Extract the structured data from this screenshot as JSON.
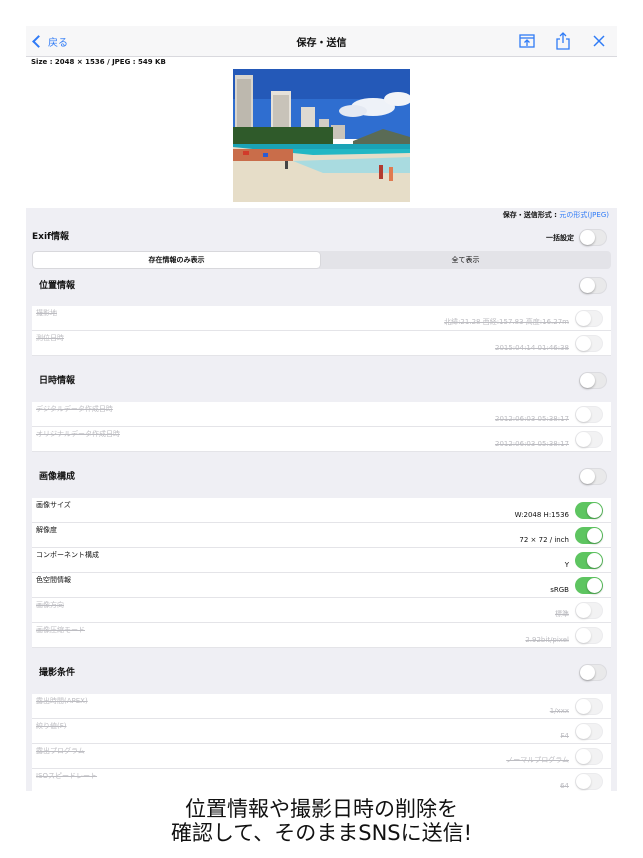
{
  "nav": {
    "back_label": "戻る",
    "title": "保存・送信"
  },
  "size_info": "Size : 2048 × 1536 / JPEG : 549 KB",
  "format": {
    "label": "保存・送信形式 : ",
    "value": "元の形式(JPEG)"
  },
  "exif": {
    "title": "Exif情報",
    "bulk_label": "一括設定"
  },
  "segments": {
    "existing_only": "存在情報のみ表示",
    "show_all": "全て表示"
  },
  "groups": {
    "location": {
      "title": "位置情報",
      "rows": [
        {
          "label": "撮影地",
          "value": "北緯:21.28 西経:157.83 高度:16.27m"
        },
        {
          "label": "測位日時",
          "value": "2015:04:14 01:46:38"
        }
      ]
    },
    "datetime": {
      "title": "日時情報",
      "rows": [
        {
          "label": "デジタルデータ作成日時",
          "value": "2012:06:03 05:38:17"
        },
        {
          "label": "オリジナルデータ作成日時",
          "value": "2012:06:03 05:38:17"
        }
      ]
    },
    "image": {
      "title": "画像構成",
      "rows": [
        {
          "label": "画像サイズ",
          "value": "W:2048 H:1536",
          "on": true
        },
        {
          "label": "解像度",
          "value": "72 × 72 / inch",
          "on": true
        },
        {
          "label": "コンポーネント構成",
          "value": "Y",
          "on": true
        },
        {
          "label": "色空間情報",
          "value": "sRGB",
          "on": true
        },
        {
          "label": "画像方向",
          "value": "標準",
          "on": false
        },
        {
          "label": "画像圧縮モード",
          "value": "2.92bit/pixel",
          "on": false
        }
      ]
    },
    "shooting": {
      "title": "撮影条件",
      "rows": [
        {
          "label": "露出時間(APEX)",
          "value": "1/xxx"
        },
        {
          "label": "絞り値(F)",
          "value": "F4"
        },
        {
          "label": "露出プログラム",
          "value": "ノーマルプログラム"
        },
        {
          "label": "ISOスピードレート",
          "value": "64"
        }
      ]
    }
  },
  "caption": {
    "line1": "位置情報や撮影日時の削除を",
    "line2": "確認して、そのままSNSに送信!"
  },
  "colors": {
    "accent": "#2f7bf6",
    "toggle_on": "#5ec561"
  }
}
